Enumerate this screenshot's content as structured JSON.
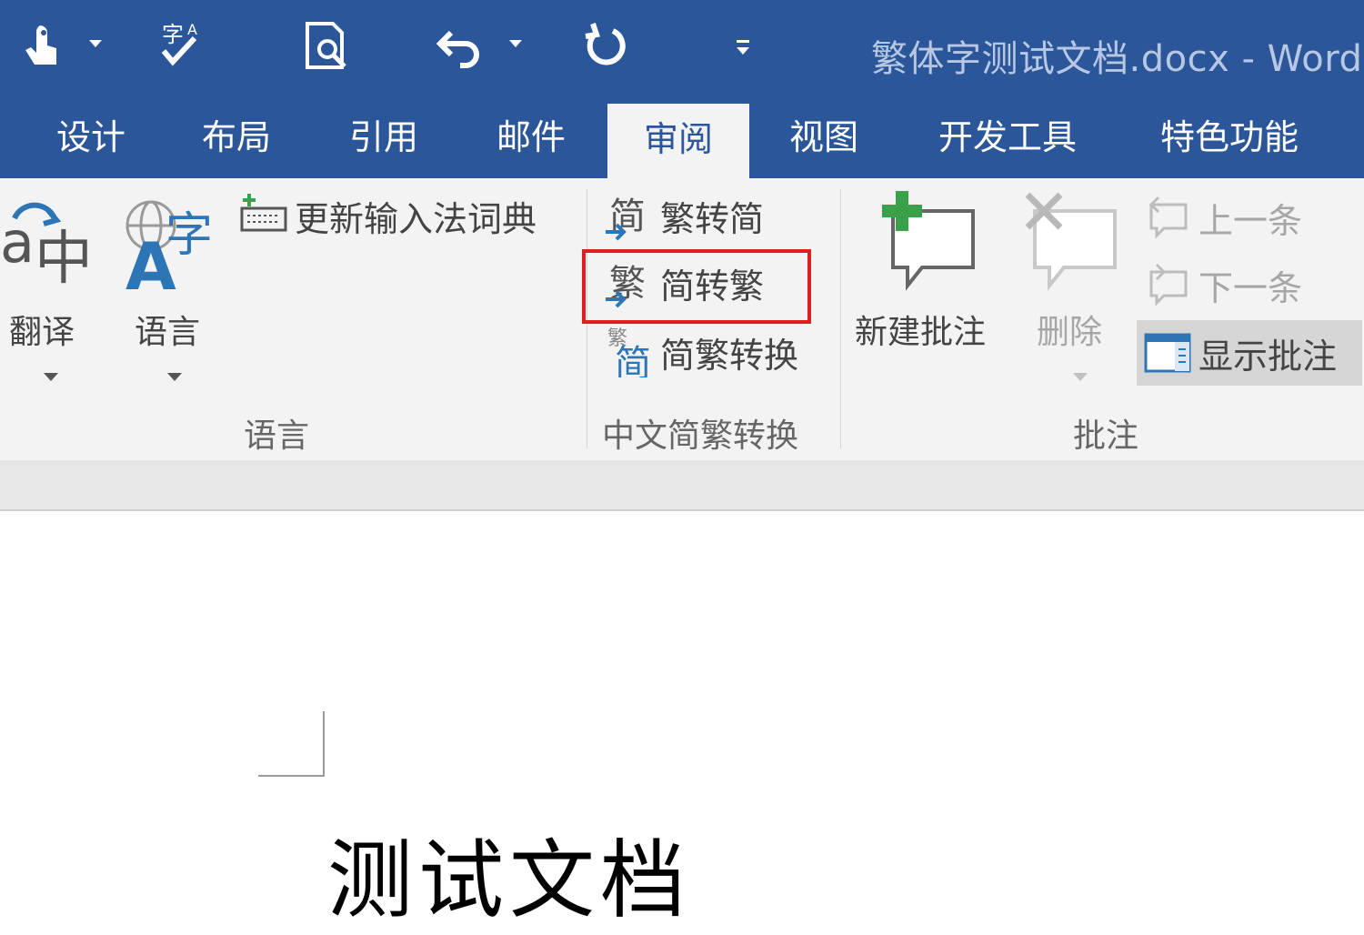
{
  "window": {
    "title": "繁体字测试文档.docx - Word"
  },
  "tabs": [
    {
      "label": "设计"
    },
    {
      "label": "布局"
    },
    {
      "label": "引用"
    },
    {
      "label": "邮件"
    },
    {
      "label": "审阅",
      "active": true
    },
    {
      "label": "视图"
    },
    {
      "label": "开发工具"
    },
    {
      "label": "特色功能"
    }
  ],
  "ribbon": {
    "language_group": {
      "label": "语言",
      "translate": "翻译",
      "language": "语言",
      "update_ime": "更新输入法词典"
    },
    "chinese_conversion_group": {
      "label": "中文简繁转换",
      "trad_to_simp": "繁转简",
      "simp_to_trad": "简转繁",
      "conversion": "简繁转换",
      "highlighted_item": "简转繁"
    },
    "comments_group": {
      "label": "批注",
      "new_comment": "新建批注",
      "delete": "删除",
      "previous": "上一条",
      "next": "下一条",
      "show_comments": "显示批注"
    }
  },
  "document": {
    "text": "测试文档"
  },
  "colors": {
    "title_bar": "#2b579a",
    "ribbon_bg": "#f3f3f3",
    "highlight_border": "#e02020",
    "accent_blue": "#2e75b6",
    "green_plus": "#3aa04a"
  }
}
